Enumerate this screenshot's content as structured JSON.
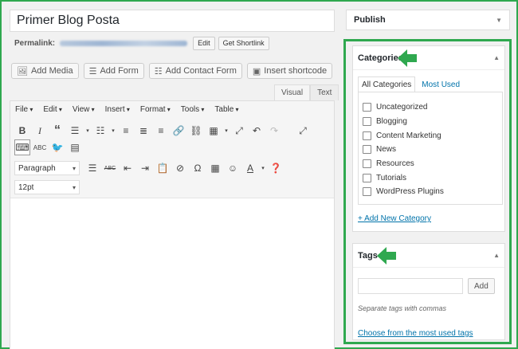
{
  "post": {
    "title": "Primer Blog Posta",
    "permalink_label": "Permalink:",
    "edit_label": "Edit",
    "shortlink_label": "Get Shortlink"
  },
  "media_buttons": [
    {
      "label": "Add Media",
      "icon": "media-icon"
    },
    {
      "label": "Add Form",
      "icon": "form-icon"
    },
    {
      "label": "Add Contact Form",
      "icon": "contact-form-icon"
    },
    {
      "label": "Insert shortcode",
      "icon": "shortcode-icon"
    }
  ],
  "editor": {
    "tab_visual": "Visual",
    "tab_text": "Text",
    "menu": [
      "File",
      "Edit",
      "View",
      "Insert",
      "Format",
      "Tools",
      "Table"
    ],
    "format_select": "Paragraph",
    "size_select": "12pt"
  },
  "sidebar": {
    "publish_title": "Publish",
    "categories": {
      "title": "Categories",
      "tab_all": "All Categories",
      "tab_used": "Most Used",
      "items": [
        "Uncategorized",
        "Blogging",
        "Content Marketing",
        "News",
        "Resources",
        "Tutorials",
        "WordPress Plugins"
      ],
      "add_new": "+ Add New Category"
    },
    "tags": {
      "title": "Tags",
      "add_label": "Add",
      "help": "Separate tags with commas",
      "choose": "Choose from the most used tags"
    }
  },
  "colors": {
    "highlight_green": "#2fa84f",
    "link_blue": "#0073aa"
  }
}
